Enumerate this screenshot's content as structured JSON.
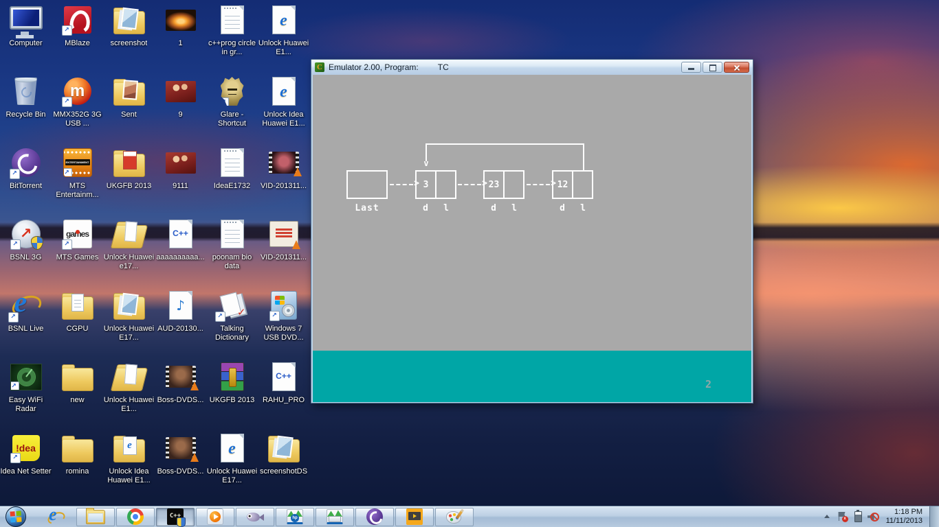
{
  "desktop": {
    "items": [
      {
        "label": "Computer",
        "icon": "computer",
        "shortcut": false
      },
      {
        "label": "MBlaze",
        "icon": "mblaze",
        "shortcut": true
      },
      {
        "label": "screenshot",
        "icon": "folder-images",
        "shortcut": false
      },
      {
        "label": "1",
        "icon": "photo-fire",
        "shortcut": false
      },
      {
        "label": "c++prog circle in gr...",
        "icon": "text-file",
        "shortcut": false
      },
      {
        "label": "Unlock Huawei E1...",
        "icon": "ie-document",
        "shortcut": false
      },
      {
        "label": "Recycle Bin",
        "icon": "recycle-bin",
        "shortcut": false
      },
      {
        "label": "MMX352G 3G USB ...",
        "icon": "mmx-modem",
        "shortcut": true
      },
      {
        "label": "Sent",
        "icon": "folder-photo",
        "shortcut": false
      },
      {
        "label": "9",
        "icon": "photo-people",
        "shortcut": false
      },
      {
        "label": "Glare - Shortcut",
        "icon": "glare-game",
        "shortcut": true
      },
      {
        "label": "Unlock Idea Huawei E1...",
        "icon": "ie-document",
        "shortcut": false
      },
      {
        "label": "BitTorrent",
        "icon": "bittorrent",
        "shortcut": true
      },
      {
        "label": "MTS Entertainm...",
        "icon": "mts-entertainment",
        "shortcut": true
      },
      {
        "label": "UKGFB 2013",
        "icon": "folder-pdf",
        "shortcut": false
      },
      {
        "label": "9111",
        "icon": "photo-people",
        "shortcut": false
      },
      {
        "label": "IdeaE1732",
        "icon": "text-file",
        "shortcut": false
      },
      {
        "label": "VID-201311...",
        "icon": "video-thumb-red",
        "shortcut": false
      },
      {
        "label": "BSNL 3G",
        "icon": "bsnl-3g",
        "shortcut": true
      },
      {
        "label": "MTS Games",
        "icon": "mts-games",
        "shortcut": true
      },
      {
        "label": "Unlock Huawei e17...",
        "icon": "folder-open",
        "shortcut": false
      },
      {
        "label": "aaaaaaaaaa...",
        "icon": "cpp-document",
        "shortcut": false
      },
      {
        "label": "poonam bio data",
        "icon": "text-file",
        "shortcut": false
      },
      {
        "label": "VID-201311...",
        "icon": "video-thumb-bollywood",
        "shortcut": false
      },
      {
        "label": "BSNL Live",
        "icon": "internet-explorer",
        "shortcut": true
      },
      {
        "label": "CGPU",
        "icon": "folder-documents",
        "shortcut": false
      },
      {
        "label": "Unlock Huawei E17...",
        "icon": "folder-images",
        "shortcut": false
      },
      {
        "label": "AUD-20130...",
        "icon": "audio-file",
        "shortcut": false
      },
      {
        "label": "Talking Dictionary",
        "icon": "talking-dictionary",
        "shortcut": true
      },
      {
        "label": "Windows 7 USB DVD...",
        "icon": "win7-usb-tool",
        "shortcut": true
      },
      {
        "label": "Easy WiFi Radar",
        "icon": "wifi-radar",
        "shortcut": true
      },
      {
        "label": "new",
        "icon": "folder-plain",
        "shortcut": false
      },
      {
        "label": "Unlock Huawei E1...",
        "icon": "folder-open",
        "shortcut": false
      },
      {
        "label": "Boss-DVDS...",
        "icon": "video-thumb-boss",
        "shortcut": false
      },
      {
        "label": "UKGFB 2013",
        "icon": "winrar-archive",
        "shortcut": false
      },
      {
        "label": "RAHU_PRO",
        "icon": "cpp-document",
        "shortcut": false
      },
      {
        "label": "Idea Net Setter",
        "icon": "idea-netsetter",
        "shortcut": true
      },
      {
        "label": "romina",
        "icon": "folder-plain",
        "shortcut": false
      },
      {
        "label": "Unlock Idea Huawei E1...",
        "icon": "folder-iedoc",
        "shortcut": false
      },
      {
        "label": "Boss-DVDS...",
        "icon": "video-thumb-boss",
        "shortcut": false
      },
      {
        "label": "Unlock Huawei E17...",
        "icon": "ie-document",
        "shortcut": false
      },
      {
        "label": "screenshotDS",
        "icon": "folder-images",
        "shortcut": false
      }
    ]
  },
  "window": {
    "title": "Emulator 2.00, Program:",
    "program": "TC",
    "window_icon": "tc-window-icon",
    "controls": [
      "minimize-icon",
      "maximize-icon",
      "close-icon"
    ]
  },
  "emulator_screen": {
    "background_color": "#a9a9a9",
    "status_area_color": "#00a6a6",
    "drawing_color": "#ffffff",
    "page_indicator": "2",
    "diagram": {
      "type": "circular-linked-list",
      "head_box_label": "Last",
      "node_cell_labels": [
        "d",
        "l"
      ],
      "nodes": [
        {
          "data": "3"
        },
        {
          "data": "23"
        },
        {
          "data": "12"
        }
      ],
      "arrow_glyph": "--->",
      "back_edge": "last-node link loops back to first node"
    }
  },
  "taskbar": {
    "buttons": [
      {
        "icon": "ie",
        "framed": false,
        "active": false
      },
      {
        "icon": "explorer",
        "framed": true,
        "active": false
      },
      {
        "icon": "chrome",
        "framed": true,
        "active": false
      },
      {
        "icon": "tc",
        "framed": true,
        "active": true
      },
      {
        "icon": "wmp",
        "framed": true,
        "active": false
      },
      {
        "icon": "fish",
        "framed": true,
        "active": false
      },
      {
        "icon": "hp",
        "framed": true,
        "active": false
      },
      {
        "icon": "scanner",
        "framed": true,
        "active": false
      },
      {
        "icon": "bittorrent",
        "framed": true,
        "active": false
      },
      {
        "icon": "video-player",
        "framed": true,
        "active": false
      },
      {
        "icon": "paint",
        "framed": true,
        "active": false
      }
    ],
    "tray": {
      "icons": [
        "hidden-icons-arrow",
        "action-center-flag",
        "battery",
        "volume-muted"
      ],
      "time": "1:18 PM",
      "date": "11/11/2013"
    }
  }
}
